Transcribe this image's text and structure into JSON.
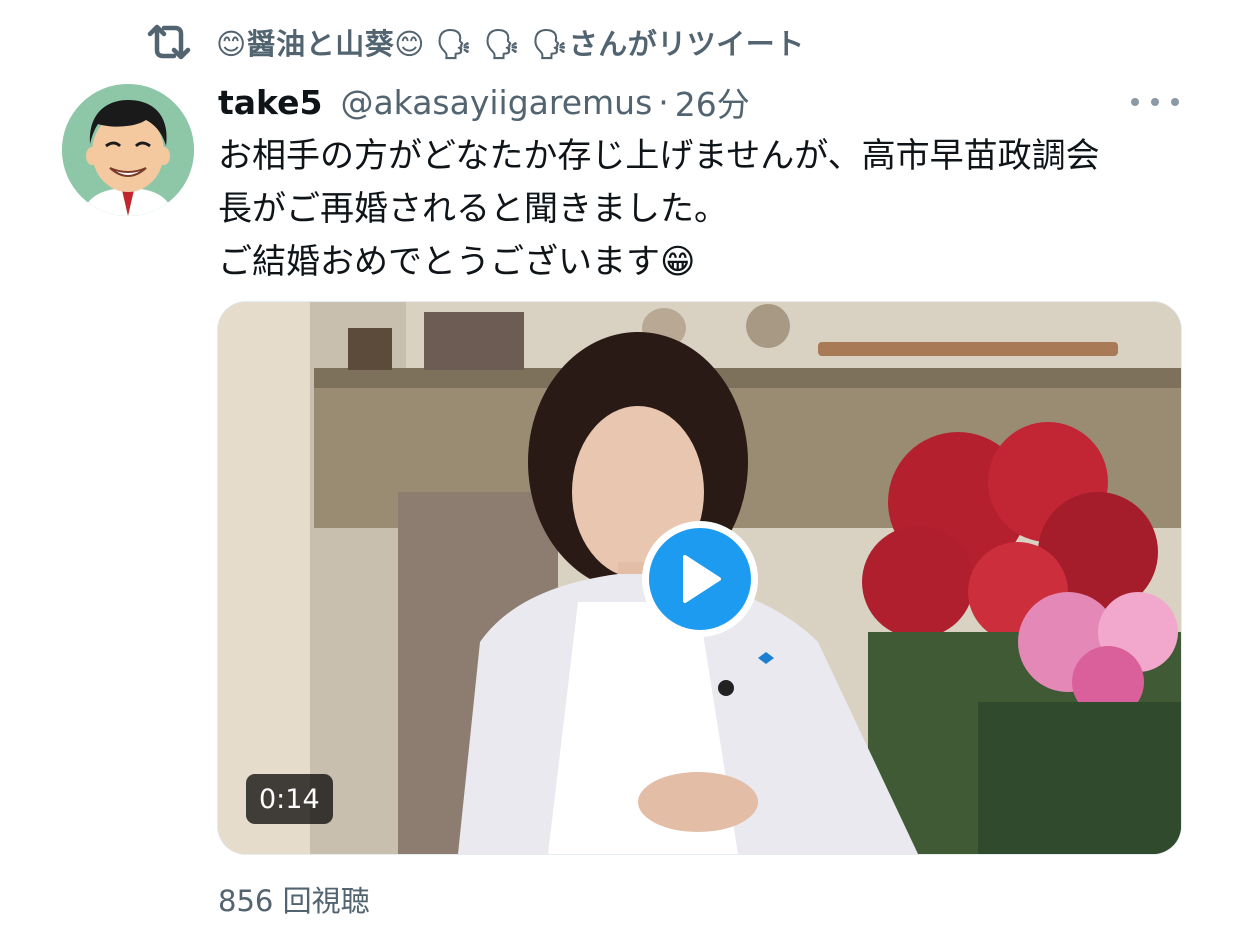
{
  "retweet": {
    "text": "😊醤油と山葵😊 🗣 🗣 🗣さんがリツイート"
  },
  "tweet": {
    "display_name": "take5",
    "handle": "@akasayiigaremus",
    "separator": "·",
    "time": "26分",
    "text_lines": [
      "お相手の方がどなたか存じ上げませんが、高市早苗政調会",
      "長がご再婚されると聞きました。",
      "ご結婚おめでとうございます😁"
    ]
  },
  "media": {
    "type": "video",
    "duration": "0:14",
    "play_icon": "play-icon"
  },
  "stats": {
    "views": "856 回視聴"
  },
  "icons": {
    "retweet": "retweet-icon",
    "more": "more-icon"
  },
  "colors": {
    "accent": "#1d9bf0",
    "secondary_text": "#536471",
    "primary_text": "#0f1419"
  }
}
